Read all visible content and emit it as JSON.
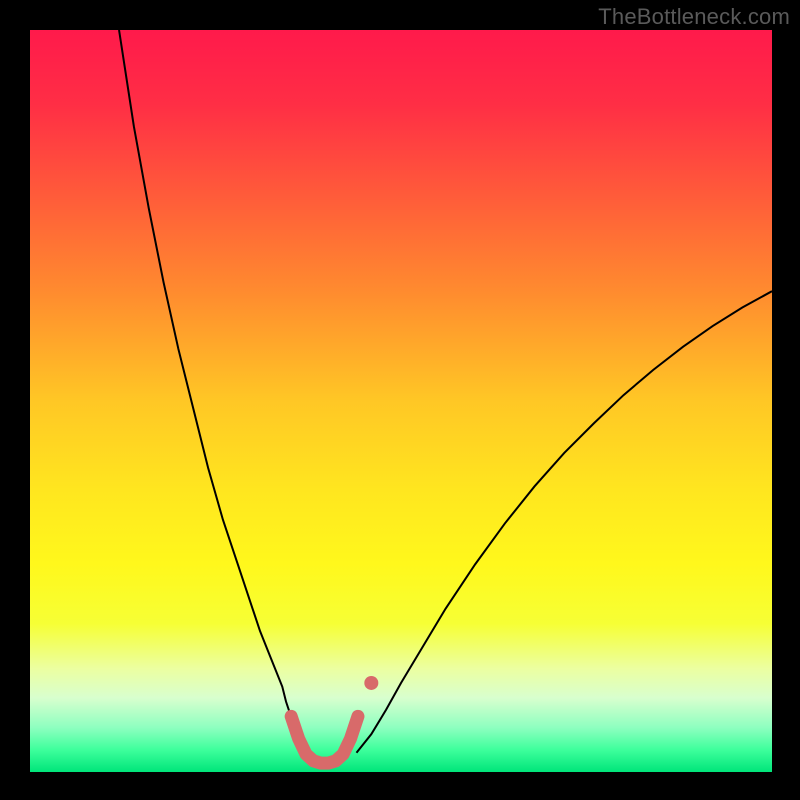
{
  "attribution": "TheBottleneck.com",
  "chart_data": {
    "type": "line",
    "title": "",
    "xlabel": "",
    "ylabel": "",
    "xlim": [
      0,
      100
    ],
    "ylim": [
      0,
      100
    ],
    "grid": false,
    "legend": false,
    "background_gradient": {
      "stops": [
        {
          "offset": 0.0,
          "color": "#ff1a4b"
        },
        {
          "offset": 0.1,
          "color": "#ff2e45"
        },
        {
          "offset": 0.22,
          "color": "#ff5a3a"
        },
        {
          "offset": 0.35,
          "color": "#ff8a2f"
        },
        {
          "offset": 0.5,
          "color": "#ffc725"
        },
        {
          "offset": 0.62,
          "color": "#ffe61f"
        },
        {
          "offset": 0.72,
          "color": "#fff81c"
        },
        {
          "offset": 0.8,
          "color": "#f6ff35"
        },
        {
          "offset": 0.86,
          "color": "#ecffa0"
        },
        {
          "offset": 0.9,
          "color": "#d8ffce"
        },
        {
          "offset": 0.94,
          "color": "#8effc0"
        },
        {
          "offset": 0.97,
          "color": "#3eff9c"
        },
        {
          "offset": 1.0,
          "color": "#00e57a"
        }
      ]
    },
    "series": [
      {
        "name": "left-branch",
        "style": {
          "stroke": "#000000",
          "width": 2
        },
        "x": [
          12,
          14,
          16,
          18,
          20,
          22,
          24,
          26,
          28,
          30,
          31,
          32,
          33,
          34,
          34.5,
          35,
          35.8,
          36.5,
          37,
          37.5
        ],
        "y": [
          100,
          87,
          76,
          66,
          57,
          49,
          41,
          34,
          28,
          22,
          19,
          16.5,
          14,
          11.5,
          9.5,
          8,
          6.3,
          4.8,
          3.6,
          2.6
        ]
      },
      {
        "name": "right-branch",
        "style": {
          "stroke": "#000000",
          "width": 2
        },
        "x": [
          44,
          46,
          48,
          50,
          53,
          56,
          60,
          64,
          68,
          72,
          76,
          80,
          84,
          88,
          92,
          96,
          100
        ],
        "y": [
          2.6,
          5.1,
          8.4,
          12,
          17,
          22,
          28,
          33.5,
          38.5,
          43,
          47,
          50.8,
          54.2,
          57.3,
          60.1,
          62.6,
          64.8
        ]
      },
      {
        "name": "trough-highlight",
        "style": {
          "stroke": "#d86a6a",
          "width": 13,
          "linecap": "round"
        },
        "x": [
          35.2,
          36.2,
          37.2,
          38.2,
          39.2,
          40.2,
          41.2,
          42.2,
          43.2,
          44.2
        ],
        "y": [
          7.5,
          4.5,
          2.4,
          1.5,
          1.2,
          1.2,
          1.5,
          2.4,
          4.5,
          7.5
        ]
      },
      {
        "name": "trough-dot-right",
        "style": {
          "fill": "#d86a6a",
          "radius": 7
        },
        "type_hint": "scatter",
        "x": [
          46.0
        ],
        "y": [
          12.0
        ]
      }
    ]
  }
}
